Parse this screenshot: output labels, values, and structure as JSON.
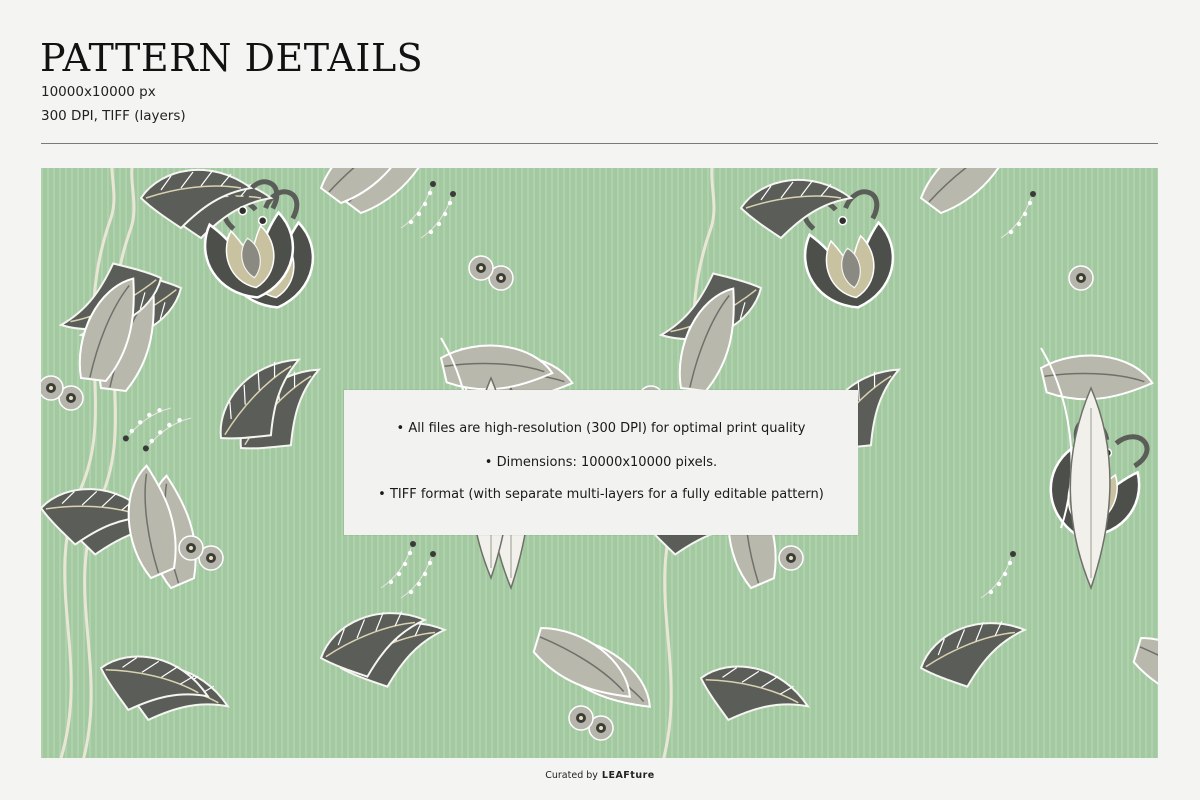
{
  "header": {
    "title": "PATTERN DETAILS",
    "spec_size": "10000x10000 px",
    "spec_format": "300 DPI, TIFF (layers)"
  },
  "pattern": {
    "background_color": "#a3c9a1",
    "motif": "jacobean-floral-icon"
  },
  "info_box": {
    "lines": [
      "• All files are high-resolution (300 DPI) for optimal print quality",
      "• Dimensions: 10000x10000 pixels.",
      "• TIFF format (with separate multi-layers for a fully editable pattern)"
    ]
  },
  "footer": {
    "prefix": "Curated by",
    "brand": "LEAFture"
  }
}
